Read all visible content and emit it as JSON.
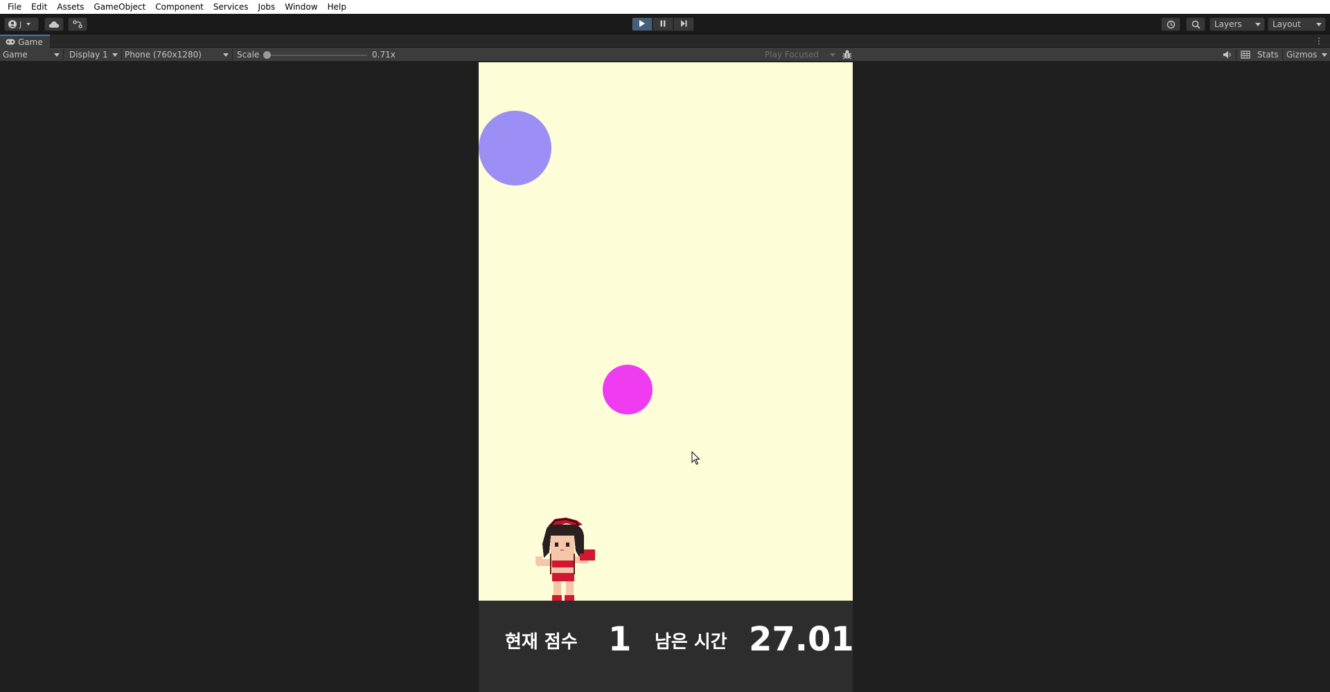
{
  "menu": [
    "File",
    "Edit",
    "Assets",
    "GameObject",
    "Component",
    "Services",
    "Jobs",
    "Window",
    "Help"
  ],
  "toolbar": {
    "account_label": "J",
    "layers_label": "Layers",
    "layout_label": "Layout",
    "play_active": true
  },
  "tab": {
    "label": "Game"
  },
  "gamebar": {
    "mode": "Game",
    "display": "Display 1",
    "resolution": "Phone (760x1280)",
    "scale_label": "Scale",
    "scale_value": "0.71x",
    "play_mode": "Play Focused",
    "stats_label": "Stats",
    "gizmos_label": "Gizmos"
  },
  "game": {
    "background": "#fdfdd8",
    "ball_colors": [
      "#9b8ef5",
      "#f03cf0"
    ],
    "hud": {
      "score_label": "현재 점수",
      "score_value": "1",
      "time_label": "남은 시간",
      "time_value": "27.01"
    }
  },
  "colors": {
    "accent": "#3a79bb",
    "play_active": "#46607c",
    "editor_bg": "#1f1f1f"
  }
}
